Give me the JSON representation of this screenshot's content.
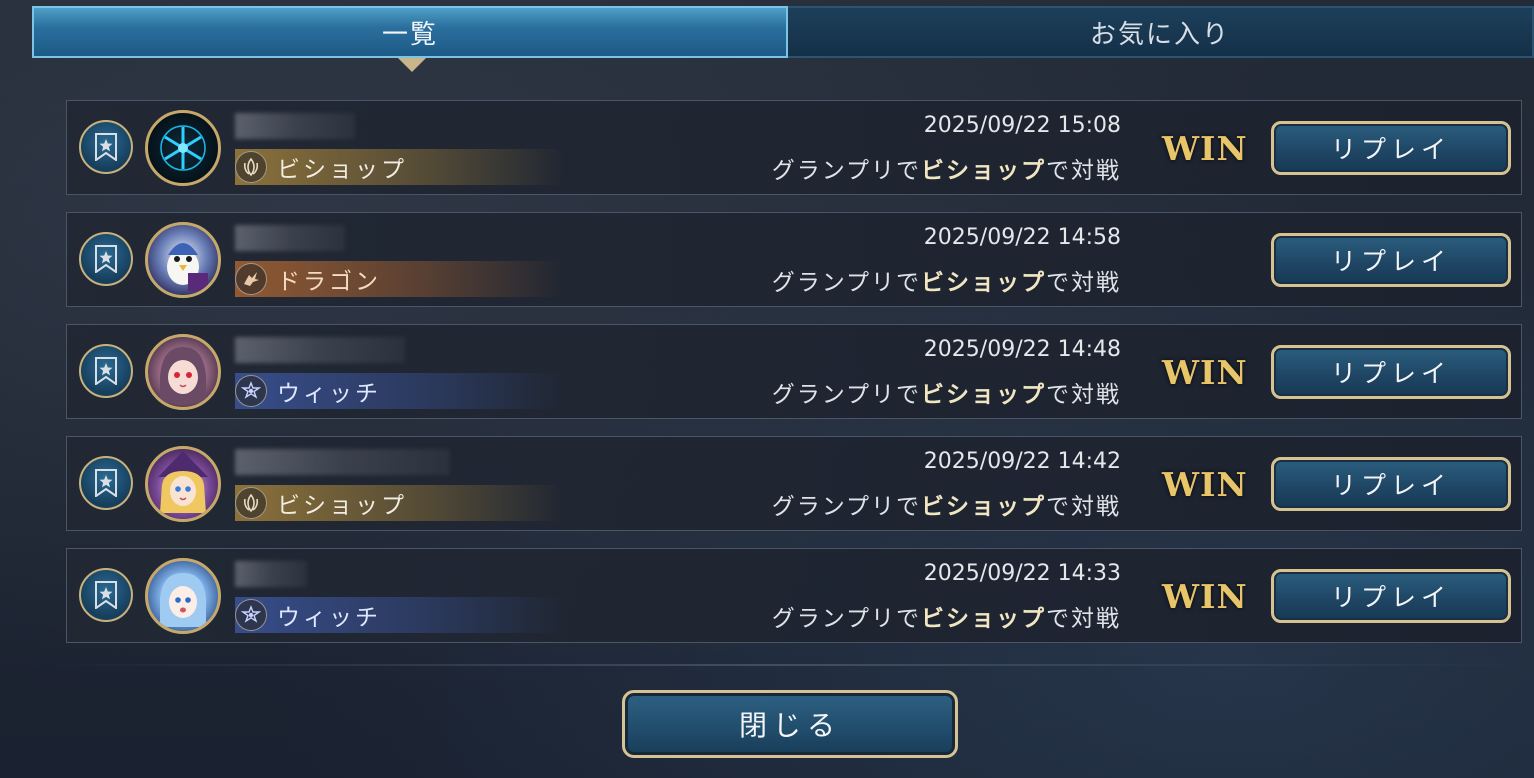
{
  "tabs": [
    {
      "label": "一覧",
      "active": true
    },
    {
      "label": "お気に入り",
      "active": false
    }
  ],
  "matches": [
    {
      "class": "ビショップ",
      "class_icon": "bishop-icon",
      "class_color": "#b08a3c",
      "avatar": "snowflake-emblem",
      "datetime": "2025/09/22 15:08",
      "match_prefix": "グランプリで",
      "match_class": "ビショップ",
      "match_suffix": "で対戦",
      "result": "WIN",
      "replay_label": "リプレイ"
    },
    {
      "class": "ドラゴン",
      "class_icon": "dragon-icon",
      "class_color": "#b86a32",
      "avatar": "penguin-character",
      "datetime": "2025/09/22 14:58",
      "match_prefix": "グランプリで",
      "match_class": "ビショップ",
      "match_suffix": "で対戦",
      "result": "",
      "replay_label": "リプレイ"
    },
    {
      "class": "ウィッチ",
      "class_icon": "witch-icon",
      "class_color": "#3f5aa8",
      "avatar": "red-eyed-girl",
      "datetime": "2025/09/22 14:48",
      "match_prefix": "グランプリで",
      "match_class": "ビショップ",
      "match_suffix": "で対戦",
      "result": "WIN",
      "replay_label": "リプレイ"
    },
    {
      "class": "ビショップ",
      "class_icon": "bishop-icon",
      "class_color": "#b08a3c",
      "avatar": "blonde-witch-girl",
      "datetime": "2025/09/22 14:42",
      "match_prefix": "グランプリで",
      "match_class": "ビショップ",
      "match_suffix": "で対戦",
      "result": "WIN",
      "replay_label": "リプレイ"
    },
    {
      "class": "ウィッチ",
      "class_icon": "witch-icon",
      "class_color": "#3f5aa8",
      "avatar": "blue-hair-girl",
      "datetime": "2025/09/22 14:33",
      "match_prefix": "グランプリで",
      "match_class": "ビショップ",
      "match_suffix": "で対戦",
      "result": "WIN",
      "replay_label": "リプレイ"
    }
  ],
  "close_label": "閉じる",
  "colors": {
    "accent_gold": "#d6c293",
    "win_gold": "#e9c56a",
    "tab_active": "#2b6f9e"
  }
}
